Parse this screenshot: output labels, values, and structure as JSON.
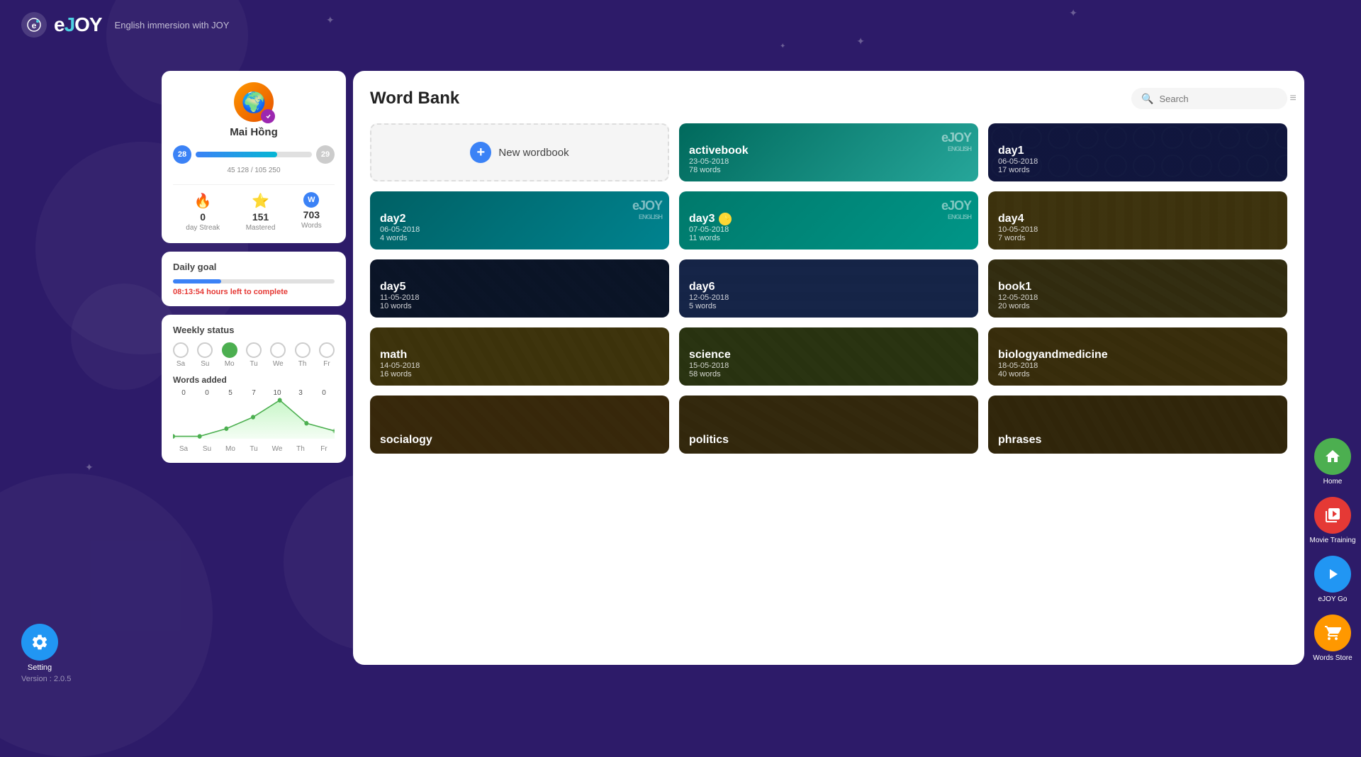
{
  "app": {
    "name": "eJoy",
    "tagline": "English immersion with JOY",
    "version": "Version : 2.0.5"
  },
  "profile": {
    "name": "Mai Hồng",
    "level_current": 28,
    "level_next": 29,
    "xp_current": 45128,
    "xp_total": 105250,
    "xp_display": "45 128 / 105 250",
    "streak": 0,
    "streak_label": "day Streak",
    "mastered": 151,
    "mastered_label": "Mastered",
    "words": 703,
    "words_label": "Words"
  },
  "daily_goal": {
    "title": "Daily goal",
    "time_left": "08:13:54",
    "time_label": "hours left to complete"
  },
  "weekly_status": {
    "title": "Weekly status",
    "days": [
      "Sa",
      "Su",
      "Mo",
      "Tu",
      "We",
      "Th",
      "Fr"
    ],
    "active_day": 2,
    "words_added_title": "Words added",
    "chart_values": [
      0,
      0,
      5,
      7,
      10,
      3,
      0
    ],
    "chart_days": [
      "Sa",
      "Su",
      "Mo",
      "Tu",
      "We",
      "Th",
      "Fr"
    ]
  },
  "word_bank": {
    "title": "Word Bank",
    "search_placeholder": "Search",
    "new_wordbook_label": "New wordbook",
    "wordbooks": [
      {
        "id": "new",
        "type": "new"
      },
      {
        "id": "activebook",
        "title": "activebook",
        "date": "23-05-2018",
        "words": "78 words",
        "style": "teal",
        "ejoy": true
      },
      {
        "id": "day1",
        "title": "day1",
        "date": "06-05-2018",
        "words": "17 words",
        "style": "dark",
        "ejoy": false
      },
      {
        "id": "day2",
        "title": "day2",
        "date": "06-05-2018",
        "words": "4 words",
        "style": "teal2",
        "ejoy": true
      },
      {
        "id": "day3",
        "title": "day3",
        "date": "07-05-2018",
        "words": "11 words",
        "style": "teal3",
        "ejoy": true,
        "star": true
      },
      {
        "id": "day4",
        "title": "day4",
        "date": "10-05-2018",
        "words": "7 words",
        "style": "forest",
        "ejoy": false
      },
      {
        "id": "day5",
        "title": "day5",
        "date": "11-05-2018",
        "words": "10 words",
        "style": "dark2",
        "ejoy": false
      },
      {
        "id": "day6",
        "title": "day6",
        "date": "12-05-2018",
        "words": "5 words",
        "style": "classroom",
        "ejoy": false
      },
      {
        "id": "book1",
        "title": "book1",
        "date": "12-05-2018",
        "words": "20 words",
        "style": "road",
        "ejoy": false
      },
      {
        "id": "math",
        "title": "math",
        "date": "14-05-2018",
        "words": "16 words",
        "style": "road2",
        "ejoy": false
      },
      {
        "id": "science",
        "title": "science",
        "date": "15-05-2018",
        "words": "58 words",
        "style": "road3",
        "ejoy": false
      },
      {
        "id": "biologyandmedicine",
        "title": "biologyandmedicine",
        "date": "18-05-2018",
        "words": "40 words",
        "style": "road4",
        "ejoy": false
      },
      {
        "id": "socialogy",
        "title": "socialogy",
        "date": "",
        "words": "",
        "style": "road5",
        "ejoy": false
      },
      {
        "id": "politics",
        "title": "politics",
        "date": "",
        "words": "",
        "style": "road6",
        "ejoy": false
      },
      {
        "id": "phrases",
        "title": "phrases",
        "date": "",
        "words": "",
        "style": "road7",
        "ejoy": false
      }
    ]
  },
  "nav": {
    "home_label": "Home",
    "movie_label": "Movie Training",
    "ejoy_go_label": "eJOY Go",
    "words_store_label": "Words Store",
    "setting_label": "Setting"
  }
}
